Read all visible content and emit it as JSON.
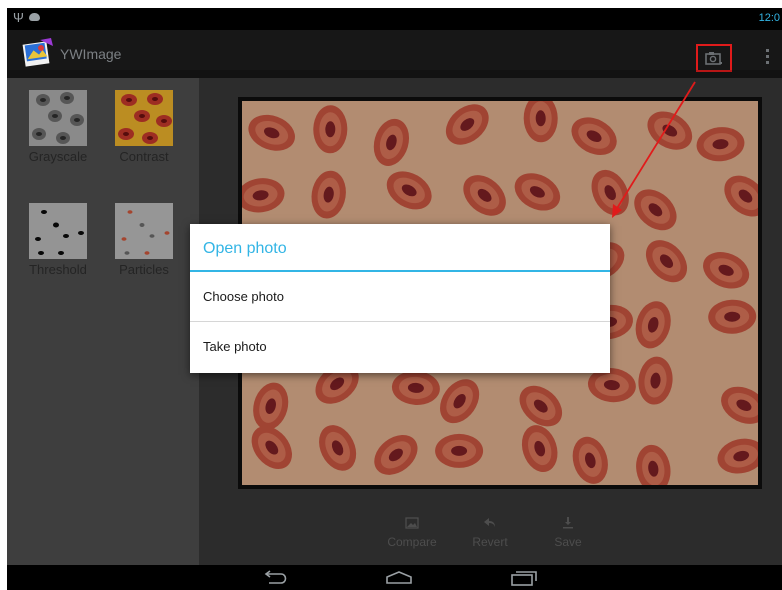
{
  "status_bar": {
    "time": "12:0",
    "usb_icon": "usb-icon",
    "notification_icon": "android-notification-icon"
  },
  "action_bar": {
    "title": "YWImage",
    "camera_icon": "camera-icon",
    "overflow_icon": "overflow-menu-icon"
  },
  "filters": [
    {
      "label": "Grayscale",
      "icon": "grayscale-thumbnail"
    },
    {
      "label": "Contrast",
      "icon": "contrast-thumbnail"
    },
    {
      "label": "Threshold",
      "icon": "threshold-thumbnail"
    },
    {
      "label": "Particles",
      "icon": "particles-thumbnail"
    }
  ],
  "bottom_bar": {
    "compare": "Compare",
    "revert": "Revert",
    "save": "Save"
  },
  "dialog": {
    "title": "Open photo",
    "options": [
      "Choose photo",
      "Take photo"
    ]
  },
  "annotation": {
    "highlight_color": "#e01b1b",
    "accent": "#33b5e5"
  }
}
